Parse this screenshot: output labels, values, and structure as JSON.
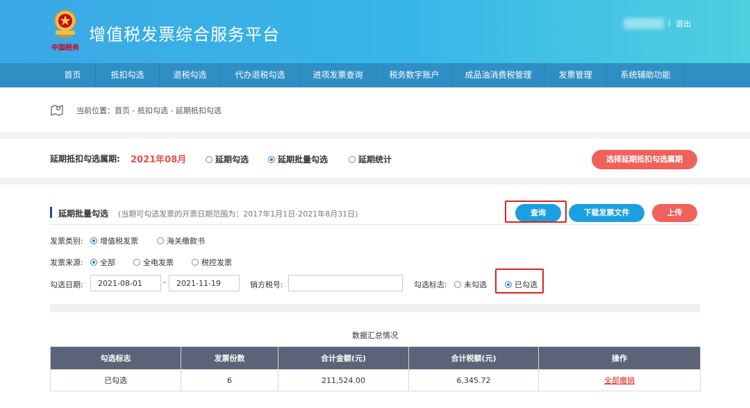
{
  "header": {
    "title": "增值税发票综合服务平台",
    "brand_sign": "中国税务",
    "user_separator": "|",
    "logout": "退出"
  },
  "nav": {
    "items": [
      {
        "label": "首页"
      },
      {
        "label": "抵扣勾选"
      },
      {
        "label": "退税勾选"
      },
      {
        "label": "代办退税勾选"
      },
      {
        "label": "进项发票查询"
      },
      {
        "label": "税务数字账户"
      },
      {
        "label": "成品油消费税管理"
      },
      {
        "label": "发票管理"
      },
      {
        "label": "系统辅助功能"
      }
    ]
  },
  "breadcrumb": {
    "text": "当前位置：首页 - 抵扣勾选 - 延期抵扣勾选"
  },
  "period": {
    "label": "延期抵扣勾选属期:",
    "value": "2021年08月",
    "options": [
      "延期勾选",
      "延期批量勾选",
      "延期统计"
    ],
    "selected_index": 1,
    "select_button": "选择延期抵扣勾选属期"
  },
  "section": {
    "title": "延期批量勾选",
    "note": "(当期可勾选发票的开票日期范围为：2017年1月1日-2021年8月31日)",
    "query_button": "查询",
    "download_button": "下载发票文件",
    "upload_button": "上传"
  },
  "form": {
    "invoice_type_label": "发票类别:",
    "invoice_type_options": [
      "增值税发票",
      "海关缴款书"
    ],
    "invoice_source_label": "发票来源:",
    "invoice_source_options": [
      "全部",
      "全电发票",
      "税控发票"
    ],
    "date_label": "勾选日期:",
    "date_from": "2021-08-01",
    "date_separator": "-",
    "date_to": "2021-11-19",
    "seller_tax_label": "销方税号:",
    "seller_tax_value": "",
    "check_flag_label": "勾选标志:",
    "check_flag_options": [
      "未勾选",
      "已勾选"
    ]
  },
  "summary": {
    "title": "数据汇总情况",
    "columns": [
      "勾选标志",
      "发票份数",
      "合计金额(元)",
      "合计税额(元)",
      "操作"
    ],
    "rows": [
      {
        "flag": "已勾选",
        "count": "6",
        "amount": "211,524.00",
        "tax": "6,345.72",
        "action": "全部撤销"
      }
    ]
  },
  "colors": {
    "header_gradient_start": "#3aa8e6",
    "header_gradient_end": "#4ed0e0",
    "nav_bg": "#2f8fc5",
    "accent_blue": "#1c9fe0",
    "accent_red": "#f0615c",
    "table_header_bg": "#5a6378",
    "highlight_red": "#e0201a"
  }
}
